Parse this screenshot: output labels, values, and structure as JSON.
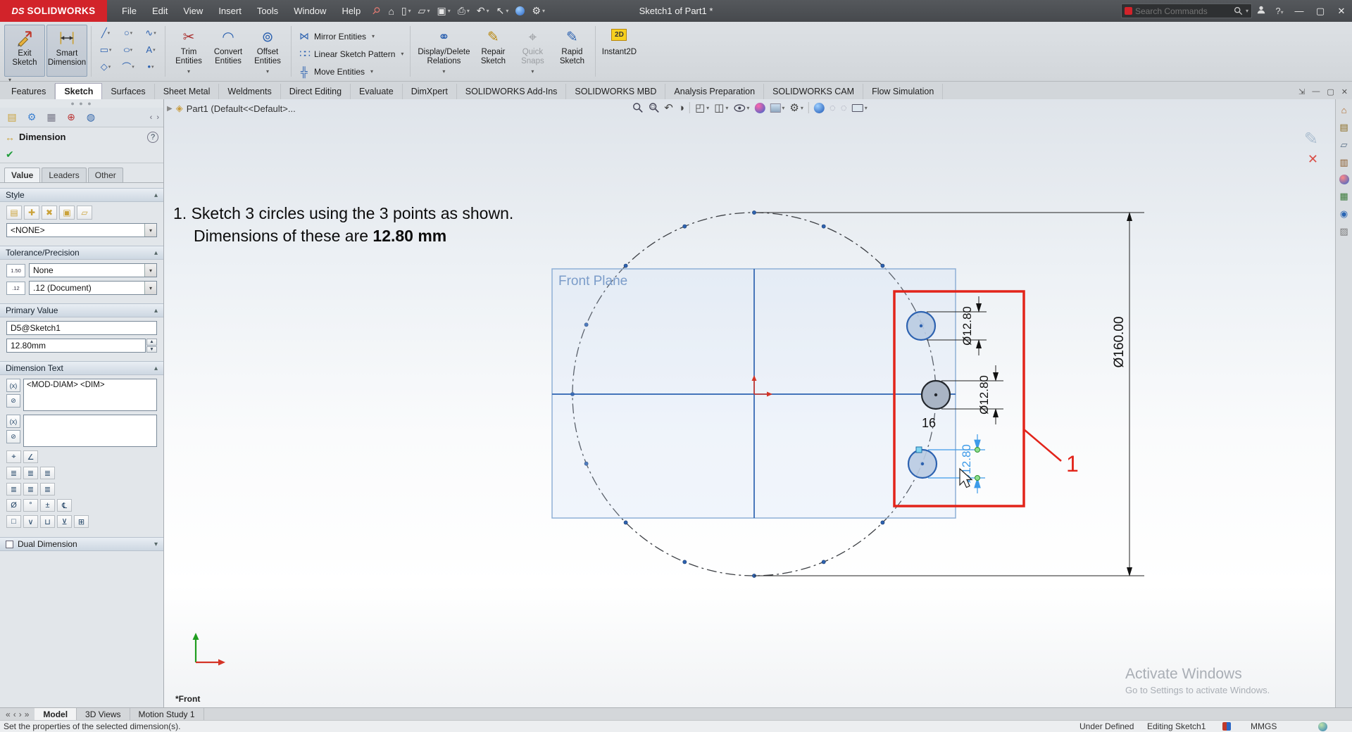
{
  "titlebar": {
    "app_name_ds": "DS",
    "app_name": "SOLIDWORKS",
    "menus": [
      "File",
      "Edit",
      "View",
      "Insert",
      "Tools",
      "Window",
      "Help"
    ],
    "document_title": "Sketch1 of Part1 *",
    "search_placeholder": "Search Commands"
  },
  "icons": {
    "home": "⌂",
    "new_document": "▯",
    "open": "▱",
    "save": "▣",
    "print": "⎙",
    "undo": "↶",
    "redo": "↷",
    "select": "↖",
    "settings": "⚙",
    "pin": "⚲",
    "help": "?",
    "minimize": "—",
    "maximize": "▢",
    "close": "✕",
    "fm_tab": "▤",
    "pm_tab": "⚙",
    "cfg_tab": "▦",
    "dimxpert_tab": "⊕",
    "display_tab": "◍",
    "nav_prev": "‹",
    "nav_next": "›",
    "nav_first": "«",
    "nav_last": "»",
    "tree_expand": "▶",
    "part": "◈",
    "sketch_line": "╱",
    "sketch_circle": "○",
    "sketch_spline": "∿",
    "sketch_rect": "▭",
    "sketch_ellipse": "○",
    "sketch_text": "A",
    "sketch_polygon": "◇",
    "sketch_arc": "⌒",
    "sketch_point": "•",
    "trim": "✂",
    "convert": "◠",
    "offset": "⊚",
    "mirror": "⋈",
    "linear_pattern": "∷∷",
    "move": "╬",
    "relations": "⚭",
    "repair": "✎",
    "quick_snaps": "⌖",
    "rapid": "✎",
    "instant2d": "2D",
    "prev_view": "↶",
    "section_view": "◑",
    "view_orientation": "◰",
    "display_style": "◫",
    "view_settings": "⚙",
    "render1": "◌",
    "render2": "◌",
    "check": "✔",
    "dim_icon": "↔",
    "tol_icon1": "1.50",
    "tol_icon2": ".12",
    "dtxt_icon1": "(x)",
    "dtxt_icon2": "⊘",
    "sym_center": "⌖",
    "sym_angle": "∠",
    "sym_justify": "≣",
    "sym_diameter": "Ø",
    "sym_degree": "°",
    "sym_plusminus": "±",
    "sym_centerline": "℄",
    "sym_square": "□",
    "sym_vee": "∨",
    "sym_cup": "⊔",
    "sym_xor": "⊻",
    "sym_more": "⊞",
    "task_library": "▤",
    "task_explorer": "▱",
    "task_palette": "▥",
    "task_scene": "▨",
    "task_props": "▦",
    "task_forum": "◉"
  },
  "ribbon": {
    "exit_sketch": "Exit Sketch",
    "smart_dimension": "Smart Dimension",
    "trim_entities": "Trim Entities",
    "convert_entities": "Convert Entities",
    "offset_entities": "Offset Entities",
    "mirror_entities": "Mirror Entities",
    "linear_sketch_pattern": "Linear Sketch Pattern",
    "move_entities": "Move Entities",
    "display_delete_relations": "Display/Delete Relations",
    "repair_sketch": "Repair Sketch",
    "quick_snaps": "Quick Snaps",
    "rapid_sketch": "Rapid Sketch",
    "instant2d": "Instant2D"
  },
  "command_tabs": {
    "items": [
      "Features",
      "Sketch",
      "Surfaces",
      "Sheet Metal",
      "Weldments",
      "Direct Editing",
      "Evaluate",
      "DimXpert",
      "SOLIDWORKS Add-Ins",
      "SOLIDWORKS MBD",
      "Analysis Preparation",
      "SOLIDWORKS CAM",
      "Flow Simulation"
    ],
    "active": "Sketch"
  },
  "feature_tree": {
    "breadcrumb": "Part1 (Default<<Default>..."
  },
  "property_panel": {
    "title": "Dimension",
    "tabs": [
      "Value",
      "Leaders",
      "Other"
    ],
    "style": {
      "label": "Style",
      "selected": "<NONE>"
    },
    "tolerance": {
      "label": "Tolerance/Precision",
      "tolerance_type": "None",
      "precision": ".12 (Document)"
    },
    "primary_value": {
      "label": "Primary Value",
      "name": "D5@Sketch1",
      "value": "12.80mm"
    },
    "dimension_text": {
      "label": "Dimension Text",
      "text": "<MOD-DIAM> <DIM>"
    },
    "dual_dimension": {
      "label": "Dual Dimension"
    }
  },
  "viewport": {
    "instruction": {
      "line1": "1. Sketch 3 circles using the 3 points as shown.",
      "line2_prefix": "Dimensions of these are ",
      "line2_bold": "12.80 mm"
    },
    "labels": {
      "front_plane": "Front Plane",
      "view_name": "*Front",
      "annotation_number": "1",
      "count": "16"
    },
    "dimensions": {
      "outer_circle": "Ø160.00",
      "circle_top": "Ø12.80",
      "circle_middle": "Ø12.80",
      "circle_bottom": "Ø12.80"
    },
    "watermark": {
      "line1": "Activate Windows",
      "line2": "Go to Settings to activate Windows."
    }
  },
  "bottom_tabs": {
    "items": [
      "Model",
      "3D Views",
      "Motion Study 1"
    ],
    "active": "Model"
  },
  "status_bar": {
    "message": "Set the properties of the selected dimension(s).",
    "state": "Under Defined",
    "editing": "Editing Sketch1",
    "units": "MMGS"
  }
}
